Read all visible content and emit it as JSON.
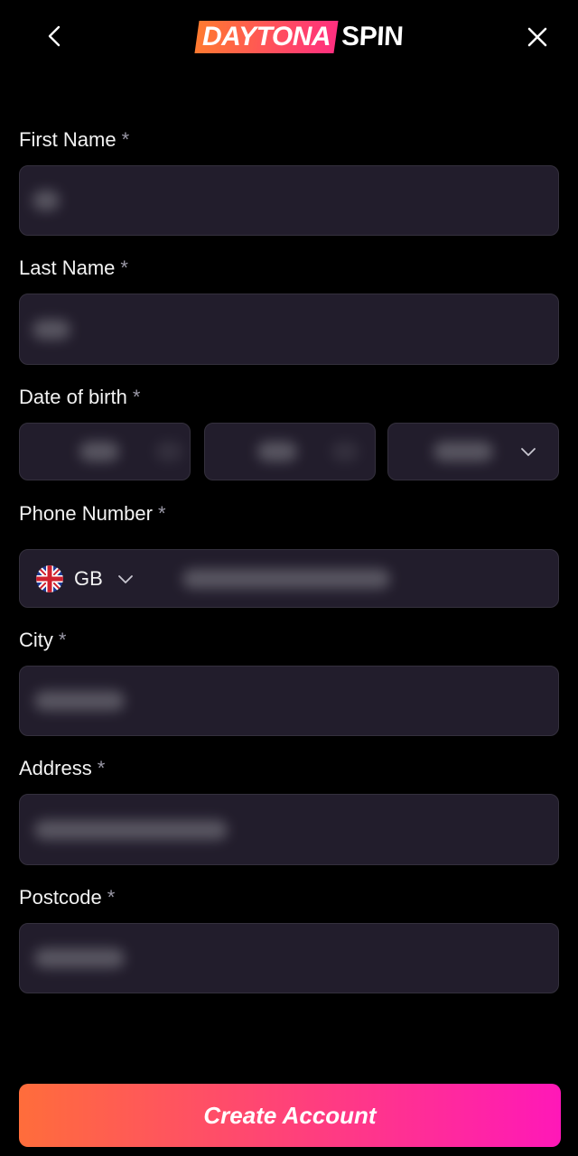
{
  "header": {
    "logo_part1": "DAYTONA",
    "logo_part2": "SPIN",
    "back_icon": "chevron-left-icon",
    "close_icon": "close-icon"
  },
  "form": {
    "required_mark": "*",
    "first_name": {
      "label": "First Name"
    },
    "last_name": {
      "label": "Last Name"
    },
    "date_of_birth": {
      "label": "Date of birth"
    },
    "phone": {
      "label": "Phone Number",
      "country_code": "GB",
      "flag_icon": "uk-flag-icon"
    },
    "city": {
      "label": "City"
    },
    "address": {
      "label": "Address"
    },
    "postcode": {
      "label": "Postcode"
    }
  },
  "submit": {
    "label": "Create Account"
  },
  "colors": {
    "background": "#000000",
    "field_bg": "#221d2c",
    "field_border": "#34303d",
    "cta_gradient_start": "#ff6d3b",
    "cta_gradient_end": "#ff18b8"
  }
}
